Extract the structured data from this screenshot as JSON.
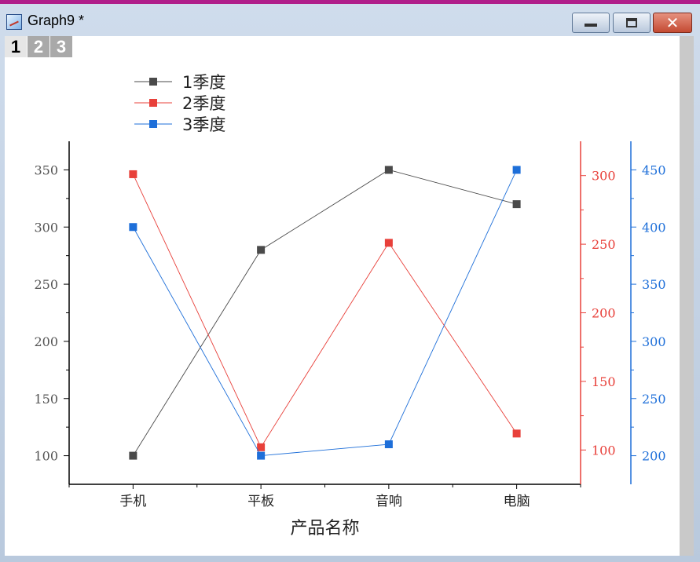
{
  "window": {
    "title": "Graph9 *",
    "close_glyph": "✕"
  },
  "layer_tabs": [
    "1",
    "2",
    "3"
  ],
  "colors": {
    "series1": "#4a4a4a",
    "series2": "#e8403a",
    "series3": "#1e6fd9"
  },
  "chart_data": {
    "type": "line",
    "xlabel": "产品名称",
    "categories": [
      "手机",
      "平板",
      "音响",
      "电脑"
    ],
    "legend_position": "top-left",
    "series": [
      {
        "name": "1季度",
        "values": [
          100,
          280,
          350,
          320
        ],
        "axis": "left",
        "ylim": [
          75,
          375
        ],
        "ticks": [
          100,
          150,
          200,
          250,
          300,
          350
        ]
      },
      {
        "name": "2季度",
        "values": [
          301,
          102,
          251,
          112
        ],
        "axis": "right-1",
        "ylim": [
          75,
          325
        ],
        "ticks": [
          100,
          150,
          200,
          250,
          300
        ]
      },
      {
        "name": "3季度",
        "values": [
          400,
          200,
          210,
          450
        ],
        "axis": "right-2",
        "ylim": [
          175,
          475
        ],
        "ticks": [
          200,
          250,
          300,
          350,
          400,
          450
        ]
      }
    ]
  }
}
